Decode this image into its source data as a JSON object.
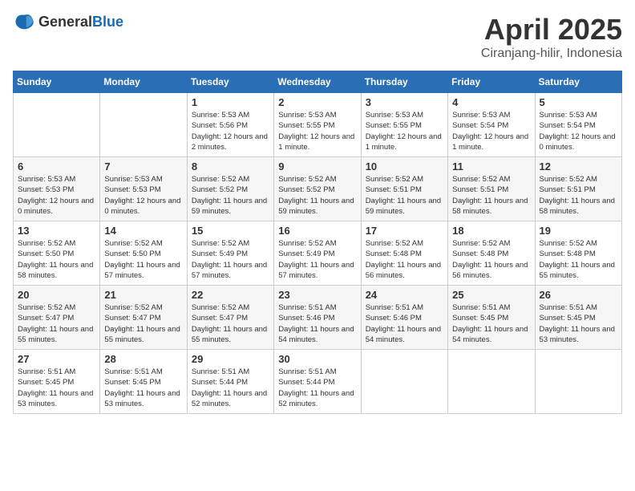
{
  "header": {
    "logo_general": "General",
    "logo_blue": "Blue",
    "title": "April 2025",
    "subtitle": "Ciranjang-hilir, Indonesia"
  },
  "days_of_week": [
    "Sunday",
    "Monday",
    "Tuesday",
    "Wednesday",
    "Thursday",
    "Friday",
    "Saturday"
  ],
  "weeks": [
    [
      {
        "day": "",
        "info": ""
      },
      {
        "day": "",
        "info": ""
      },
      {
        "day": "1",
        "info": "Sunrise: 5:53 AM\nSunset: 5:56 PM\nDaylight: 12 hours and 2 minutes."
      },
      {
        "day": "2",
        "info": "Sunrise: 5:53 AM\nSunset: 5:55 PM\nDaylight: 12 hours and 1 minute."
      },
      {
        "day": "3",
        "info": "Sunrise: 5:53 AM\nSunset: 5:55 PM\nDaylight: 12 hours and 1 minute."
      },
      {
        "day": "4",
        "info": "Sunrise: 5:53 AM\nSunset: 5:54 PM\nDaylight: 12 hours and 1 minute."
      },
      {
        "day": "5",
        "info": "Sunrise: 5:53 AM\nSunset: 5:54 PM\nDaylight: 12 hours and 0 minutes."
      }
    ],
    [
      {
        "day": "6",
        "info": "Sunrise: 5:53 AM\nSunset: 5:53 PM\nDaylight: 12 hours and 0 minutes."
      },
      {
        "day": "7",
        "info": "Sunrise: 5:53 AM\nSunset: 5:53 PM\nDaylight: 12 hours and 0 minutes."
      },
      {
        "day": "8",
        "info": "Sunrise: 5:52 AM\nSunset: 5:52 PM\nDaylight: 11 hours and 59 minutes."
      },
      {
        "day": "9",
        "info": "Sunrise: 5:52 AM\nSunset: 5:52 PM\nDaylight: 11 hours and 59 minutes."
      },
      {
        "day": "10",
        "info": "Sunrise: 5:52 AM\nSunset: 5:51 PM\nDaylight: 11 hours and 59 minutes."
      },
      {
        "day": "11",
        "info": "Sunrise: 5:52 AM\nSunset: 5:51 PM\nDaylight: 11 hours and 58 minutes."
      },
      {
        "day": "12",
        "info": "Sunrise: 5:52 AM\nSunset: 5:51 PM\nDaylight: 11 hours and 58 minutes."
      }
    ],
    [
      {
        "day": "13",
        "info": "Sunrise: 5:52 AM\nSunset: 5:50 PM\nDaylight: 11 hours and 58 minutes."
      },
      {
        "day": "14",
        "info": "Sunrise: 5:52 AM\nSunset: 5:50 PM\nDaylight: 11 hours and 57 minutes."
      },
      {
        "day": "15",
        "info": "Sunrise: 5:52 AM\nSunset: 5:49 PM\nDaylight: 11 hours and 57 minutes."
      },
      {
        "day": "16",
        "info": "Sunrise: 5:52 AM\nSunset: 5:49 PM\nDaylight: 11 hours and 57 minutes."
      },
      {
        "day": "17",
        "info": "Sunrise: 5:52 AM\nSunset: 5:48 PM\nDaylight: 11 hours and 56 minutes."
      },
      {
        "day": "18",
        "info": "Sunrise: 5:52 AM\nSunset: 5:48 PM\nDaylight: 11 hours and 56 minutes."
      },
      {
        "day": "19",
        "info": "Sunrise: 5:52 AM\nSunset: 5:48 PM\nDaylight: 11 hours and 55 minutes."
      }
    ],
    [
      {
        "day": "20",
        "info": "Sunrise: 5:52 AM\nSunset: 5:47 PM\nDaylight: 11 hours and 55 minutes."
      },
      {
        "day": "21",
        "info": "Sunrise: 5:52 AM\nSunset: 5:47 PM\nDaylight: 11 hours and 55 minutes."
      },
      {
        "day": "22",
        "info": "Sunrise: 5:52 AM\nSunset: 5:47 PM\nDaylight: 11 hours and 55 minutes."
      },
      {
        "day": "23",
        "info": "Sunrise: 5:51 AM\nSunset: 5:46 PM\nDaylight: 11 hours and 54 minutes."
      },
      {
        "day": "24",
        "info": "Sunrise: 5:51 AM\nSunset: 5:46 PM\nDaylight: 11 hours and 54 minutes."
      },
      {
        "day": "25",
        "info": "Sunrise: 5:51 AM\nSunset: 5:45 PM\nDaylight: 11 hours and 54 minutes."
      },
      {
        "day": "26",
        "info": "Sunrise: 5:51 AM\nSunset: 5:45 PM\nDaylight: 11 hours and 53 minutes."
      }
    ],
    [
      {
        "day": "27",
        "info": "Sunrise: 5:51 AM\nSunset: 5:45 PM\nDaylight: 11 hours and 53 minutes."
      },
      {
        "day": "28",
        "info": "Sunrise: 5:51 AM\nSunset: 5:45 PM\nDaylight: 11 hours and 53 minutes."
      },
      {
        "day": "29",
        "info": "Sunrise: 5:51 AM\nSunset: 5:44 PM\nDaylight: 11 hours and 52 minutes."
      },
      {
        "day": "30",
        "info": "Sunrise: 5:51 AM\nSunset: 5:44 PM\nDaylight: 11 hours and 52 minutes."
      },
      {
        "day": "",
        "info": ""
      },
      {
        "day": "",
        "info": ""
      },
      {
        "day": "",
        "info": ""
      }
    ]
  ]
}
